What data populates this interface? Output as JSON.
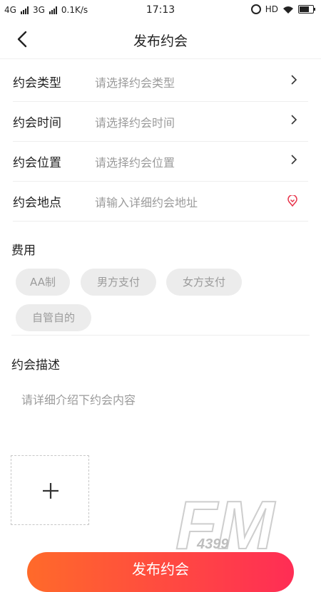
{
  "status_bar": {
    "net1": "4G",
    "net2": "3G",
    "speed": "0.1K/s",
    "time": "17:13",
    "hd": "HD",
    "battery_level": 0.7
  },
  "header": {
    "title": "发布约会"
  },
  "form": {
    "rows": [
      {
        "label": "约会类型",
        "value": "请选择约会类型",
        "icon": "chevron-right-icon"
      },
      {
        "label": "约会时间",
        "value": "请选择约会时间",
        "icon": "chevron-right-icon"
      },
      {
        "label": "约会位置",
        "value": "请选择约会位置",
        "icon": "chevron-right-icon"
      },
      {
        "label": "约会地点",
        "value": "请输入详细约会地址",
        "icon": "location-pin-icon"
      }
    ]
  },
  "cost": {
    "title": "费用",
    "options": [
      "AA制",
      "男方支付",
      "女方支付",
      "自管自的"
    ]
  },
  "description": {
    "title": "约会描述",
    "placeholder": "请详细介绍下约会内容"
  },
  "upload": {
    "icon": "plus-icon"
  },
  "submit": {
    "label": "发布约会"
  },
  "watermark": {
    "text": "FM",
    "sub": "4399"
  },
  "colors": {
    "accent_start": "#ff6a2a",
    "accent_end": "#ff2d55",
    "pin": "#e8334a"
  }
}
